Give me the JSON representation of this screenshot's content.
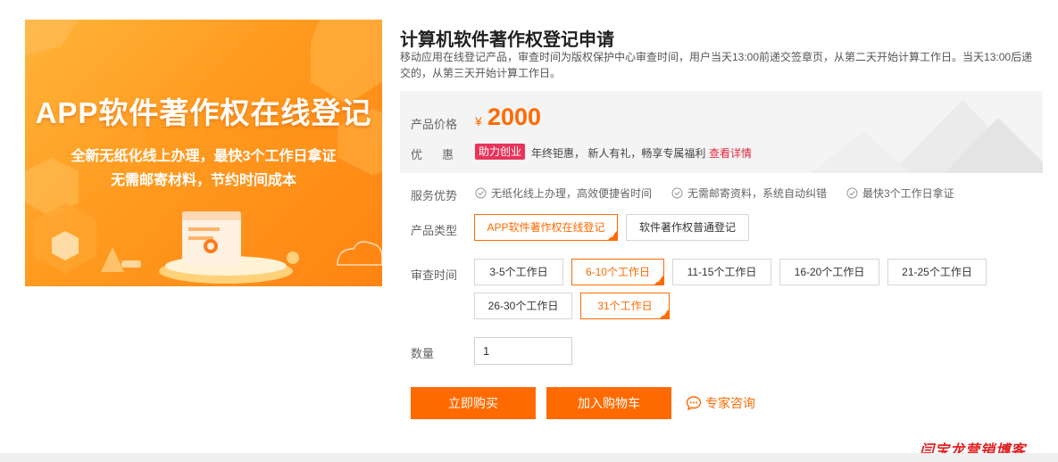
{
  "banner": {
    "title": "APP软件著作权在线登记",
    "subtitle1": "全新无纸化线上办理，最快3个工作日拿证",
    "subtitle2": "无需邮寄材料，节约时间成本"
  },
  "product": {
    "title": "计算机软件著作权登记申请",
    "description": "移动应用在线登记产品，审查时间为版权保护中心审查时间，用户当天13:00前递交签章页，从第二天开始计算工作日。当天13:00后递交的，从第三天开始计算工作日。"
  },
  "price": {
    "label": "产品价格",
    "currency": "¥",
    "value": "2000"
  },
  "promo": {
    "label": "优惠",
    "badge": "助力创业",
    "text": "年终钜惠， 新人有礼，畅享专属福利",
    "link": "查看详情"
  },
  "services": {
    "label": "服务优势",
    "items": [
      "无纸化线上办理，高效便捷省时间",
      "无需邮寄资料，系统自动纠错",
      "最快3个工作日拿证"
    ]
  },
  "product_type": {
    "label": "产品类型",
    "options": [
      "APP软件著作权在线登记",
      "软件著作权普通登记"
    ],
    "selected": "APP软件著作权在线登记"
  },
  "review_time": {
    "label": "审查时间",
    "options": [
      "3-5个工作日",
      "6-10个工作日",
      "11-15个工作日",
      "16-20个工作日",
      "21-25个工作日",
      "26-30个工作日",
      "31个工作日"
    ],
    "selected": "6-10个工作日"
  },
  "quantity": {
    "label": "数量",
    "value": "1"
  },
  "actions": {
    "buy": "立即购买",
    "cart": "加入购物车",
    "consult": "专家咨询"
  },
  "watermark": "闫宝龙营销博客",
  "colors": {
    "accent": "#ff6a00",
    "promo_badge": "#e8345a",
    "link": "#e0293b"
  }
}
